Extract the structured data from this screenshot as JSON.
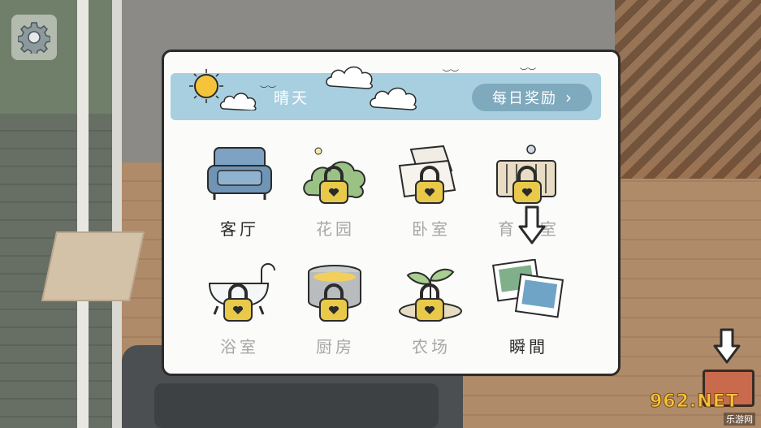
{
  "weather": {
    "label": "晴天"
  },
  "daily_reward": {
    "label": "每日奖励",
    "chevron": "›"
  },
  "rooms": [
    {
      "label": "客厅",
      "locked": false,
      "icon": "armchair-icon"
    },
    {
      "label": "花园",
      "locked": true,
      "icon": "bush-icon"
    },
    {
      "label": "卧室",
      "locked": true,
      "icon": "pillow-icon"
    },
    {
      "label": "育",
      "label_tail": "室",
      "locked": true,
      "icon": "crib-icon"
    },
    {
      "label": "浴室",
      "locked": true,
      "icon": "bathtub-icon"
    },
    {
      "label": "厨房",
      "locked": true,
      "icon": "pot-icon"
    },
    {
      "label": "农场",
      "locked": true,
      "icon": "sprout-icon"
    },
    {
      "label": "瞬間",
      "locked": false,
      "icon": "photos-icon"
    }
  ],
  "watermark": {
    "brand": "962.NET",
    "sub": "乐游网"
  },
  "colors": {
    "weather_bar": "#a8cfdf",
    "daily_button": "#7fa9bd",
    "lock_gold": "#e9c94a",
    "locked_text": "#a7a7a7",
    "unlocked_text": "#2a2a2a"
  }
}
